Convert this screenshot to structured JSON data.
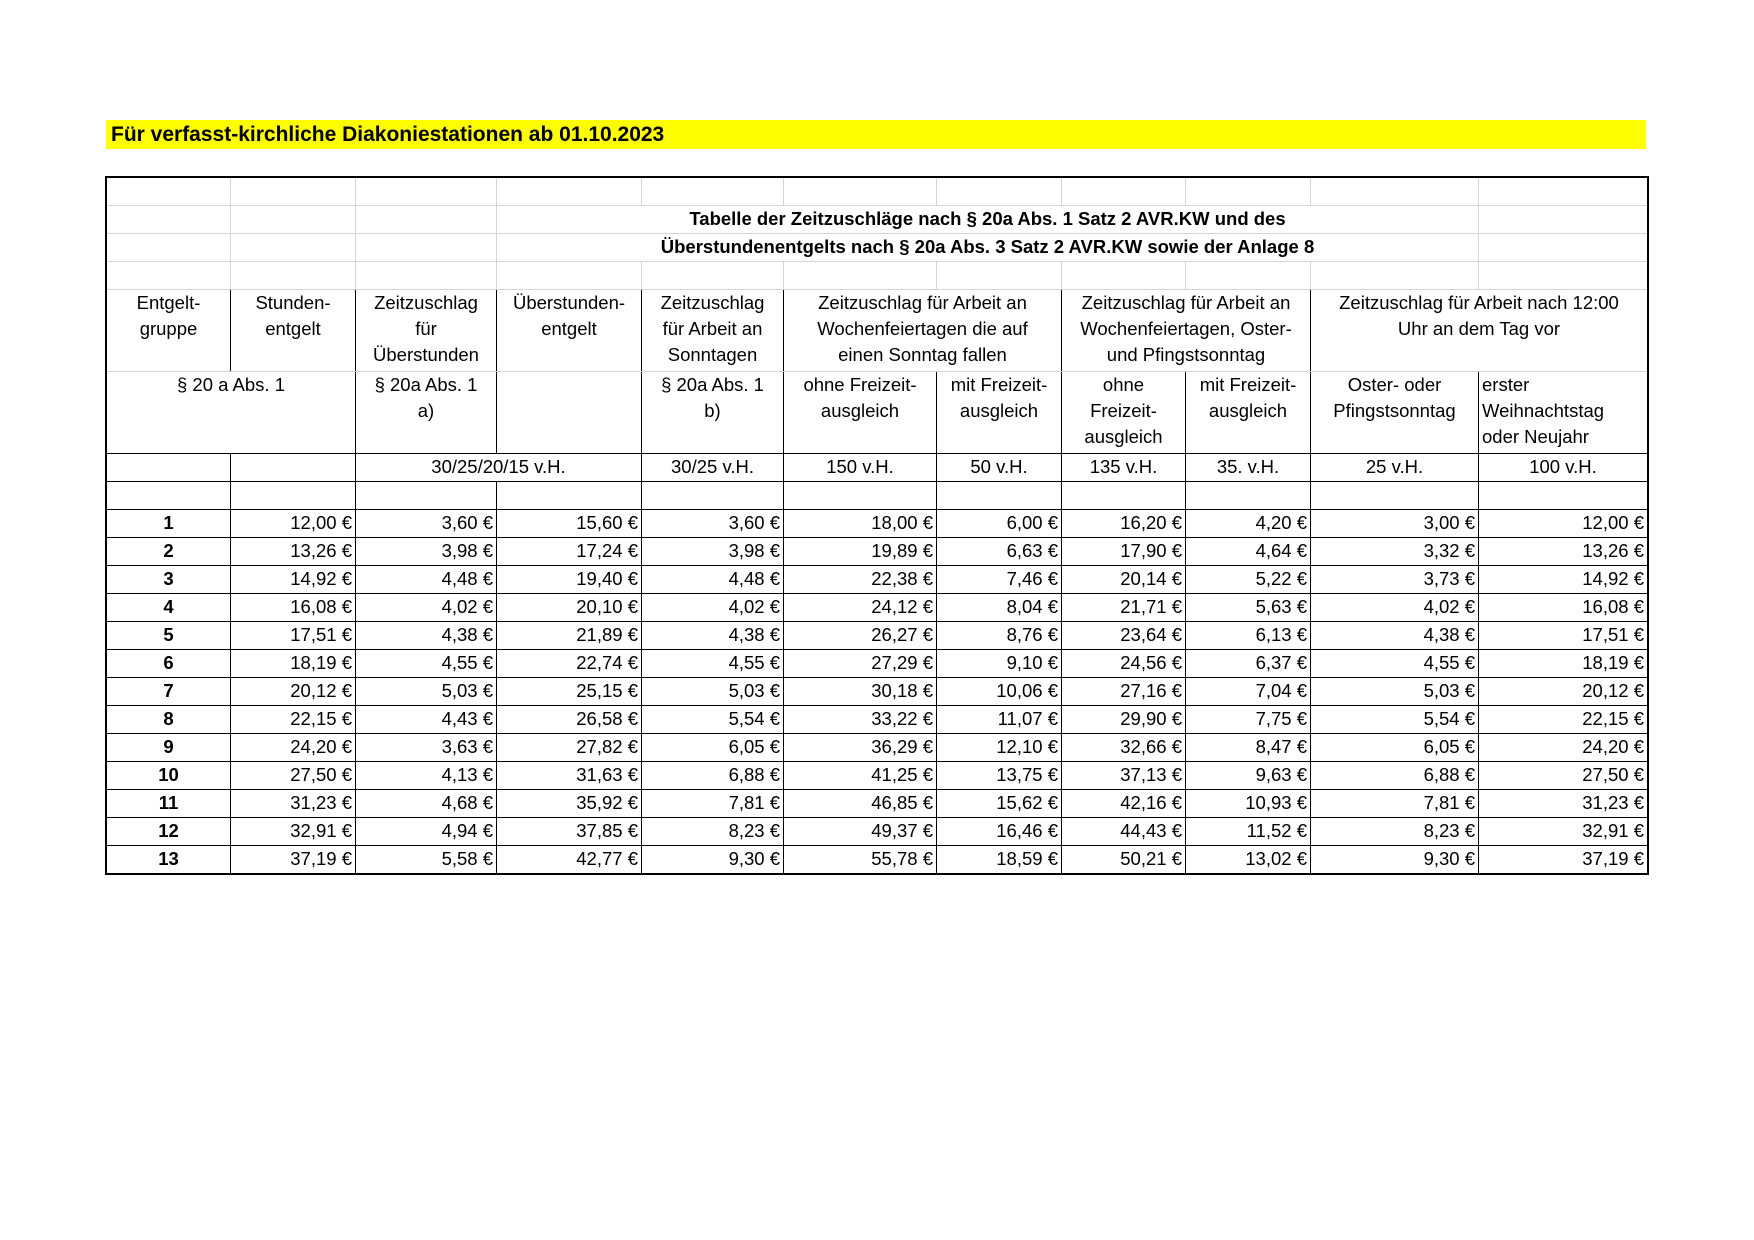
{
  "banner": "Für verfasst-kirchliche Diakoniestationen ab 01.10.2023",
  "title": {
    "line1": "Tabelle der Zeitzuschläge nach § 20a Abs. 1 Satz 2 AVR.KW und des",
    "line2": "Überstundenentgelts nach § 20a Abs. 3 Satz 2 AVR.KW sowie der Anlage 8"
  },
  "headers": {
    "gruppe": "Entgelt-\ngruppe",
    "stunden": "Stunden-\nentgelt",
    "zz_ueber": "Zeitzuschlag\nfür\nÜberstunden",
    "ueber_entgelt": "Überstunden-\nentgelt",
    "zz_sonntag": "Zeitzuschlag\nfür Arbeit an\nSonntagen",
    "zz_feiertag_sonntag": "Zeitzuschlag für Arbeit an\nWochenfeiertagen die auf\neinen Sonntag fallen",
    "zz_feiertag_oster": "Zeitzuschlag für Arbeit an\nWochenfeiertagen, Oster-\nund Pfingstsonntag",
    "zz_nach_12": "Zeitzuschlag für Arbeit nach 12:00\nUhr an dem Tag vor"
  },
  "subheaders": {
    "abs1": "§ 20 a Abs. 1",
    "abs1a": "§ 20a Abs. 1\na)",
    "abs1b": "§ 20a Abs. 1\nb)",
    "ohne1": "ohne Freizeit-\nausgleich",
    "mit1": "mit Freizeit-\nausgleich",
    "ohne2": "ohne\nFreizeit-\nausgleich",
    "mit2": "mit Freizeit-\nausgleich",
    "oster": "Oster- oder\nPfingstsonntag",
    "weihnacht": "erster\nWeihnachtstag\noder Neujahr"
  },
  "percentages": {
    "p_ueber": "30/25/20/15 v.H.",
    "p_sonntag": "30/25 v.H.",
    "p_150": "150 v.H.",
    "p_50": "50 v.H.",
    "p_135": "135 v.H.",
    "p_35": "35. v.H.",
    "p_25": "25 v.H.",
    "p_100": "100 v.H."
  },
  "rows": [
    [
      "1",
      "12,00 €",
      "3,60 €",
      "15,60 €",
      "3,60 €",
      "18,00 €",
      "6,00 €",
      "16,20 €",
      "4,20 €",
      "3,00 €",
      "12,00 €"
    ],
    [
      "2",
      "13,26 €",
      "3,98 €",
      "17,24 €",
      "3,98 €",
      "19,89 €",
      "6,63 €",
      "17,90 €",
      "4,64 €",
      "3,32 €",
      "13,26 €"
    ],
    [
      "3",
      "14,92 €",
      "4,48 €",
      "19,40 €",
      "4,48 €",
      "22,38 €",
      "7,46 €",
      "20,14 €",
      "5,22 €",
      "3,73 €",
      "14,92 €"
    ],
    [
      "4",
      "16,08 €",
      "4,02 €",
      "20,10 €",
      "4,02 €",
      "24,12 €",
      "8,04 €",
      "21,71 €",
      "5,63 €",
      "4,02 €",
      "16,08 €"
    ],
    [
      "5",
      "17,51 €",
      "4,38 €",
      "21,89 €",
      "4,38 €",
      "26,27 €",
      "8,76 €",
      "23,64 €",
      "6,13 €",
      "4,38 €",
      "17,51 €"
    ],
    [
      "6",
      "18,19 €",
      "4,55 €",
      "22,74 €",
      "4,55 €",
      "27,29 €",
      "9,10 €",
      "24,56 €",
      "6,37 €",
      "4,55 €",
      "18,19 €"
    ],
    [
      "7",
      "20,12 €",
      "5,03 €",
      "25,15 €",
      "5,03 €",
      "30,18 €",
      "10,06 €",
      "27,16 €",
      "7,04 €",
      "5,03 €",
      "20,12 €"
    ],
    [
      "8",
      "22,15 €",
      "4,43 €",
      "26,58 €",
      "5,54 €",
      "33,22 €",
      "11,07 €",
      "29,90 €",
      "7,75 €",
      "5,54 €",
      "22,15 €"
    ],
    [
      "9",
      "24,20 €",
      "3,63 €",
      "27,82 €",
      "6,05 €",
      "36,29 €",
      "12,10 €",
      "32,66 €",
      "8,47 €",
      "6,05 €",
      "24,20 €"
    ],
    [
      "10",
      "27,50 €",
      "4,13 €",
      "31,63 €",
      "6,88 €",
      "41,25 €",
      "13,75 €",
      "37,13 €",
      "9,63 €",
      "6,88 €",
      "27,50 €"
    ],
    [
      "11",
      "31,23 €",
      "4,68 €",
      "35,92 €",
      "7,81 €",
      "46,85 €",
      "15,62 €",
      "42,16 €",
      "10,93 €",
      "7,81 €",
      "31,23 €"
    ],
    [
      "12",
      "32,91 €",
      "4,94 €",
      "37,85 €",
      "8,23 €",
      "49,37 €",
      "16,46 €",
      "44,43 €",
      "11,52 €",
      "8,23 €",
      "32,91 €"
    ],
    [
      "13",
      "37,19 €",
      "5,58 €",
      "42,77 €",
      "9,30 €",
      "55,78 €",
      "18,59 €",
      "50,21 €",
      "13,02 €",
      "9,30 €",
      "37,19 €"
    ]
  ]
}
